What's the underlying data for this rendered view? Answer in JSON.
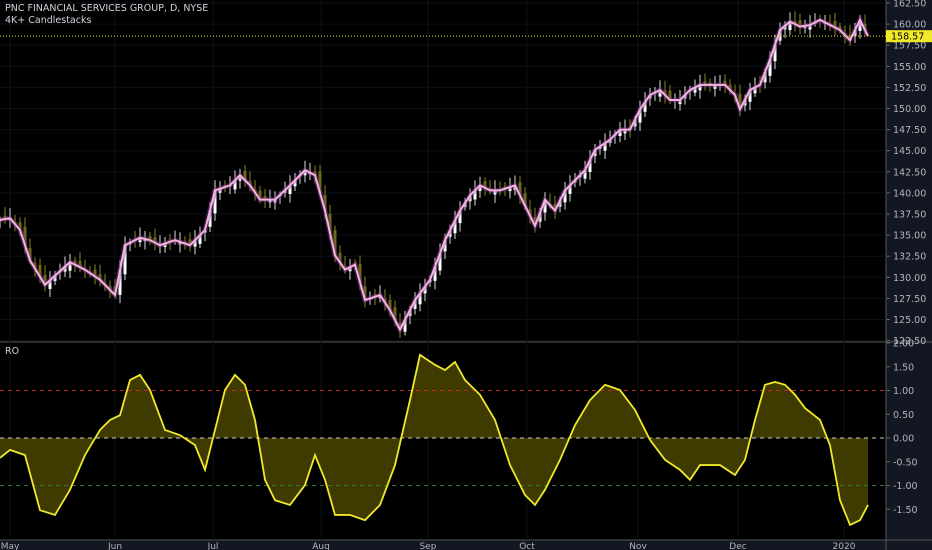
{
  "header": {
    "symbol_title": "PNC FINANCIAL SERVICES GROUP, D, NYSE",
    "indicator_name": "4K+ Candlestacks"
  },
  "oscillator_pane": {
    "label": "RO"
  },
  "last_price": "158.57",
  "colors": {
    "background": "#000000",
    "price_line": "#f7b3d9",
    "osc_line": "#f0e82a",
    "osc_fill": "#4a4500",
    "upper_level": "#c62828",
    "lower_level": "#2e7d32",
    "zero_level": "#cccccc",
    "last_price_bg": "#f0e82a"
  },
  "chart_data": [
    {
      "type": "line",
      "title": "PNC FINANCIAL SERVICES GROUP, D, NYSE",
      "ylabel": "Price",
      "ylim": [
        122.5,
        162.5
      ],
      "yticks": [
        "162.50",
        "160.00",
        "157.50",
        "155.00",
        "152.50",
        "150.00",
        "147.50",
        "145.00",
        "142.50",
        "140.00",
        "137.50",
        "135.00",
        "132.50",
        "130.00",
        "127.50",
        "125.00",
        "122.50"
      ],
      "xticks": [
        {
          "label": "May",
          "d": 2
        },
        {
          "label": "Jun",
          "d": 23
        },
        {
          "label": "Jul",
          "d": 42.6
        },
        {
          "label": "Aug",
          "d": 64.2
        },
        {
          "label": "Sep",
          "d": 85.6
        },
        {
          "label": "Oct",
          "d": 105.4
        },
        {
          "label": "Nov",
          "d": 127.6
        },
        {
          "label": "Dec",
          "d": 147.6
        },
        {
          "label": "2020",
          "d": 168.8
        }
      ],
      "d": [
        0,
        2,
        4,
        6,
        9,
        11,
        14,
        17,
        20,
        23,
        25,
        28,
        30,
        32,
        35,
        38,
        41,
        43,
        46,
        48,
        50,
        52,
        55,
        58,
        61,
        63,
        65,
        67,
        69,
        71,
        73,
        76,
        78,
        80,
        83,
        86,
        89,
        92,
        94,
        96,
        98,
        100,
        103,
        105,
        107,
        109,
        111,
        113,
        115,
        117,
        119,
        122,
        124,
        126,
        128,
        130,
        132,
        134,
        136,
        138,
        140,
        143,
        145,
        147,
        148,
        150,
        152,
        154,
        156,
        158,
        160,
        162,
        164,
        166,
        168,
        170,
        172,
        173.6
      ],
      "close": [
        136.8,
        137.0,
        135.6,
        132.0,
        129.1,
        130.2,
        131.8,
        130.9,
        129.7,
        127.9,
        133.8,
        134.7,
        134.4,
        133.8,
        134.4,
        133.8,
        135.6,
        140.3,
        140.9,
        142.1,
        140.9,
        139.2,
        139.2,
        140.9,
        142.7,
        142.1,
        137.9,
        132.6,
        130.9,
        131.5,
        127.3,
        127.9,
        126.1,
        123.8,
        127.3,
        129.7,
        134.4,
        137.9,
        139.7,
        140.9,
        140.3,
        140.3,
        140.9,
        138.5,
        136.1,
        139.2,
        137.9,
        140.3,
        141.5,
        142.7,
        145.1,
        146.3,
        147.5,
        147.5,
        149.9,
        151.6,
        152.2,
        151.0,
        151.0,
        152.2,
        152.8,
        152.8,
        152.8,
        151.6,
        149.9,
        152.2,
        152.8,
        155.8,
        159.3,
        160.3,
        159.7,
        159.9,
        160.5,
        159.9,
        159.3,
        158.1,
        160.5,
        158.57
      ]
    },
    {
      "type": "area",
      "title": "RO",
      "ylim": [
        -1.9,
        2.0
      ],
      "yticks": [
        "2.00",
        "1.50",
        "1.00",
        "0.50",
        "0.00",
        "-0.50",
        "-1.00",
        "-1.50"
      ],
      "levels": [
        1.0,
        0.0,
        -1.0
      ],
      "d": [
        0,
        2,
        5,
        8,
        11,
        14,
        17,
        20,
        22,
        24,
        26,
        28,
        30,
        33,
        36,
        39,
        41,
        43,
        45,
        47,
        49,
        51,
        53,
        55,
        58,
        61,
        63,
        65,
        67,
        70,
        73,
        76,
        79,
        82,
        84,
        87,
        89,
        91,
        93,
        96,
        99,
        102,
        105,
        107,
        109,
        112,
        115,
        118,
        121,
        124,
        127,
        130,
        133,
        136,
        138,
        140,
        142,
        144,
        147,
        149,
        151,
        153,
        155,
        157,
        159,
        161,
        164,
        166,
        168,
        170,
        172,
        173.6
      ],
      "values": [
        -0.42,
        -0.25,
        -0.36,
        -1.52,
        -1.62,
        -1.09,
        -0.36,
        0.17,
        0.38,
        0.48,
        1.22,
        1.33,
        1.01,
        0.17,
        0.06,
        -0.15,
        -0.67,
        0.17,
        1.01,
        1.33,
        1.12,
        0.38,
        -0.88,
        -1.31,
        -1.41,
        -0.99,
        -0.36,
        -0.88,
        -1.62,
        -1.62,
        -1.73,
        -1.41,
        -0.57,
        0.8,
        1.75,
        1.54,
        1.43,
        1.6,
        1.22,
        0.91,
        0.38,
        -0.57,
        -1.2,
        -1.41,
        -1.09,
        -0.46,
        0.27,
        0.8,
        1.12,
        1.01,
        0.59,
        -0.04,
        -0.46,
        -0.67,
        -0.88,
        -0.57,
        -0.57,
        -0.57,
        -0.78,
        -0.46,
        0.38,
        1.12,
        1.18,
        1.12,
        0.91,
        0.63,
        0.38,
        -0.15,
        -1.31,
        -1.83,
        -1.73,
        -1.41
      ]
    }
  ]
}
